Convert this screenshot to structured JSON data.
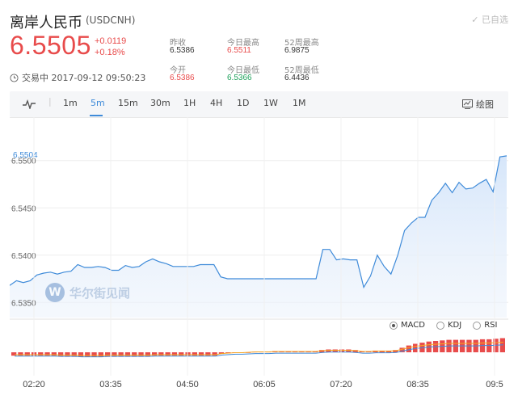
{
  "header": {
    "title": "离岸人民币",
    "code": "(USDCNH)",
    "added_label": "已自选",
    "price": "6.5505",
    "change_abs": "+0.0119",
    "change_pct": "+0.18%",
    "trade_time": "交易中 2017-09-12 09:50:23"
  },
  "stats": [
    {
      "label": "昨收",
      "value": "6.5386",
      "color": "dark"
    },
    {
      "label": "今日最高",
      "value": "6.5511",
      "color": "red"
    },
    {
      "label": "52周最高",
      "value": "6.9875",
      "color": "dark"
    },
    {
      "label": "今开",
      "value": "6.5386",
      "color": "red"
    },
    {
      "label": "今日最低",
      "value": "6.5366",
      "color": "green"
    },
    {
      "label": "52周最低",
      "value": "6.4436",
      "color": "dark"
    }
  ],
  "toolbar": {
    "intervals": [
      "1m",
      "5m",
      "15m",
      "30m",
      "1H",
      "4H",
      "1D",
      "1W",
      "1M"
    ],
    "active_interval": "5m",
    "draw_label": "绘图"
  },
  "indicators": {
    "options": [
      "MACD",
      "KDJ",
      "RSI"
    ],
    "selected": "MACD"
  },
  "watermark": {
    "logo_letter": "W",
    "text": "华尔街见闻"
  },
  "colors": {
    "up": "#e84b4b",
    "down": "#1fa15b",
    "accent": "#3f8bd9",
    "area_fill": "#d6e6fa"
  },
  "chart_data": {
    "type": "area",
    "current_value_label": "6.5504",
    "y_ticks": [
      "6.5500",
      "6.5450",
      "6.5400",
      "6.5350"
    ],
    "y_tick_values": [
      6.55,
      6.545,
      6.54,
      6.535
    ],
    "ylim": [
      6.5334,
      6.5522
    ],
    "x_ticks": [
      "02:20",
      "03:35",
      "04:50",
      "06:05",
      "07:20",
      "08:35",
      "09:5"
    ],
    "x_tick_values": [
      20,
      35,
      50,
      65,
      80,
      95,
      110
    ],
    "values": [
      6.5368,
      6.5373,
      6.5371,
      6.5373,
      6.5379,
      6.5381,
      6.5382,
      6.538,
      6.5382,
      6.5383,
      6.539,
      6.5387,
      6.5387,
      6.5388,
      6.5387,
      6.5384,
      6.5384,
      6.5389,
      6.5387,
      6.5388,
      6.5393,
      6.5396,
      6.5393,
      6.5391,
      6.5388,
      6.5388,
      6.5388,
      6.5388,
      6.539,
      6.539,
      6.539,
      6.5377,
      6.5375,
      6.5375,
      6.5375,
      6.5375,
      6.5375,
      6.5375,
      6.5375,
      6.5375,
      6.5375,
      6.5375,
      6.5375,
      6.5375,
      6.5375,
      6.5375,
      6.5406,
      6.5406,
      6.5395,
      6.5396,
      6.5395,
      6.5395,
      6.5366,
      6.5378,
      6.54,
      6.5388,
      6.538,
      6.54,
      6.5426,
      6.5434,
      6.544,
      6.544,
      6.5458,
      6.5466,
      6.5476,
      6.5466,
      6.5477,
      6.547,
      6.5471,
      6.5476,
      6.548,
      6.5467,
      6.5504,
      6.5505
    ],
    "macd_histogram": [
      -0.3,
      -0.3,
      -0.3,
      -0.3,
      -0.3,
      -0.3,
      -0.3,
      -0.35,
      -0.35,
      -0.35,
      -0.4,
      -0.4,
      -0.4,
      -0.4,
      -0.35,
      -0.35,
      -0.35,
      -0.35,
      -0.35,
      -0.35,
      -0.35,
      -0.3,
      -0.3,
      -0.3,
      -0.3,
      -0.3,
      -0.3,
      -0.3,
      -0.3,
      -0.3,
      -0.3,
      -0.15,
      -0.1,
      -0.05,
      -0.05,
      0.0,
      0.05,
      0.05,
      0.05,
      0.1,
      0.1,
      0.1,
      0.1,
      0.1,
      0.1,
      0.1,
      0.2,
      0.25,
      0.25,
      0.25,
      0.25,
      0.2,
      0.1,
      0.1,
      0.15,
      0.15,
      0.15,
      0.2,
      0.4,
      0.6,
      0.75,
      0.85,
      0.95,
      1.0,
      1.05,
      1.1,
      1.1,
      1.1,
      1.1,
      1.1,
      1.15,
      1.15,
      1.2,
      1.25
    ]
  }
}
